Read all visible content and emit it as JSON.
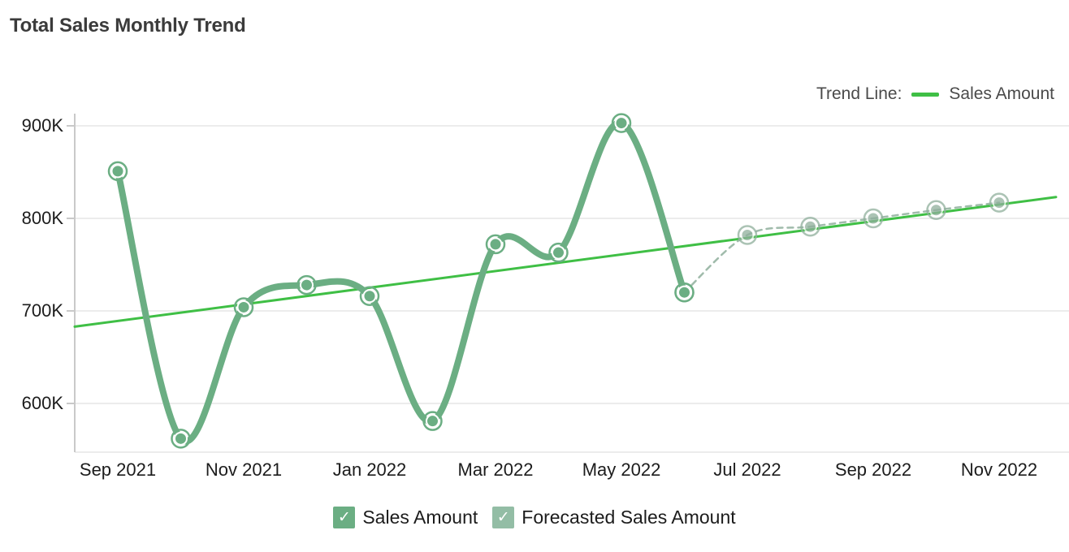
{
  "title": "Total Sales Monthly Trend",
  "trend_legend": {
    "label": "Trend Line:",
    "series_label": "Sales Amount",
    "swatch_name": "trend-line-swatch"
  },
  "series_legend": [
    {
      "label": "Sales Amount",
      "checked": "✓",
      "color": "#6BAE83",
      "name": "legend-sales-amount"
    },
    {
      "label": "Forecasted Sales Amount",
      "checked": "✓",
      "color": "#93BDA5",
      "name": "legend-forecasted-sales-amount"
    }
  ],
  "colors": {
    "actual_line": "#6BAE83",
    "forecast_line": "#8FAF9C",
    "trend_line": "#3FBF45",
    "grid": "#ececec",
    "axis": "#c9c9c9",
    "text": "#1c1c1c",
    "title": "#3b3b3b"
  },
  "chart_data": {
    "type": "line",
    "title": "Total Sales Monthly Trend",
    "xlabel": "",
    "ylabel": "",
    "ylim": [
      540000,
      930000
    ],
    "yticks": [
      600000,
      700000,
      800000,
      900000
    ],
    "ytick_labels": [
      "600K",
      "700K",
      "800K",
      "900K"
    ],
    "grid": true,
    "legend_position": "bottom-center",
    "x": [
      "Sep 2021",
      "Oct 2021",
      "Nov 2021",
      "Dec 2021",
      "Jan 2022",
      "Feb 2022",
      "Mar 2022",
      "Apr 2022",
      "May 2022",
      "Jun 2022",
      "Jul 2022",
      "Aug 2022",
      "Sep 2022",
      "Oct 2022",
      "Nov 2022"
    ],
    "xtick_labels": [
      "Sep 2021",
      "Nov 2021",
      "Jan 2022",
      "Mar 2022",
      "May 2022",
      "Jul 2022",
      "Sep 2022",
      "Nov 2022"
    ],
    "xtick_indices": [
      0,
      2,
      4,
      6,
      8,
      10,
      12,
      14
    ],
    "series": [
      {
        "name": "Sales Amount",
        "style": "solid-spline",
        "color": "#6BAE83",
        "values": [
          851000,
          562000,
          704000,
          728000,
          716000,
          581000,
          772000,
          763000,
          903000,
          720000,
          null,
          null,
          null,
          null,
          null
        ]
      },
      {
        "name": "Forecasted Sales Amount",
        "style": "dashed-spline",
        "color": "#8FAF9C",
        "values": [
          null,
          null,
          null,
          null,
          null,
          null,
          null,
          null,
          null,
          720000,
          782000,
          791000,
          800000,
          809000,
          817000
        ]
      },
      {
        "name": "Trend Line",
        "style": "straight",
        "color": "#3FBF45",
        "values": [
          683000,
          693000,
          703000,
          713000,
          723000,
          733000,
          743000,
          753000,
          763000,
          773000,
          783000,
          793000,
          803000,
          813000,
          823000
        ]
      }
    ]
  }
}
